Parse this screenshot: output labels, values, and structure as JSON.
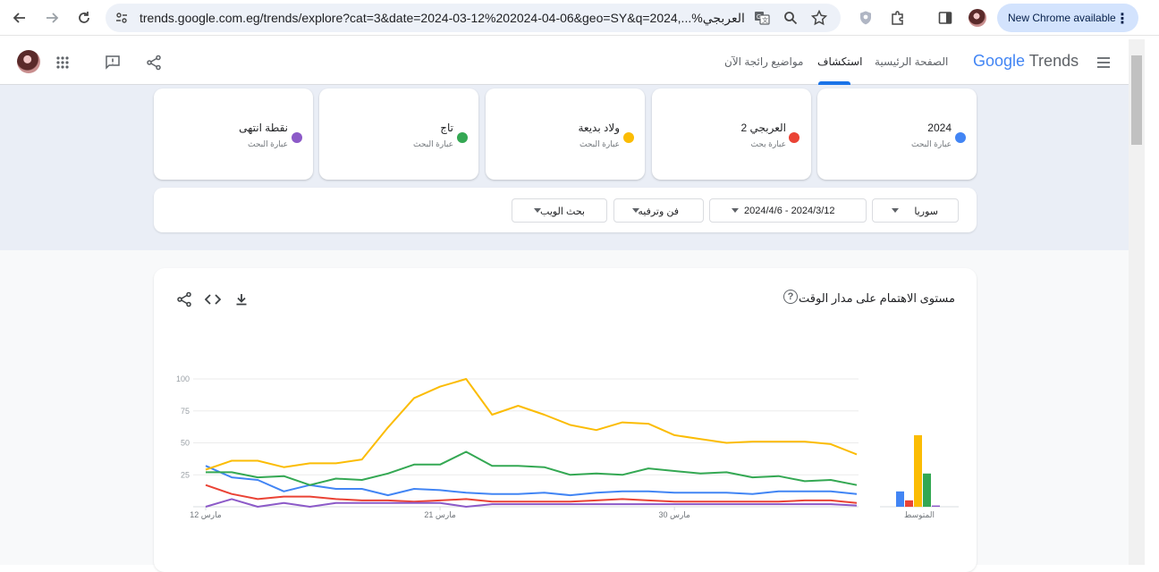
{
  "browser": {
    "url": "trends.google.com.eg/trends/explore?cat=3&date=2024-03-12%202024-04-06&geo=SY&q=2024,...%العربجي",
    "update_label": "New Chrome available"
  },
  "header": {
    "logo_google": "Google",
    "logo_trends": "Trends",
    "nav": [
      {
        "label": "الصفحة الرئيسية"
      },
      {
        "label": "استكشاف"
      },
      {
        "label": "مواضيع رائجة الآن"
      }
    ]
  },
  "terms": [
    {
      "term": "2024",
      "sub": "عبارة البحث",
      "color": "#4285f4"
    },
    {
      "term": "العربجي 2",
      "sub": "عبارة بحث",
      "color": "#ea4335"
    },
    {
      "term": "ولاد بديعة",
      "sub": "عبارة البحث",
      "color": "#fbbc04"
    },
    {
      "term": "تاج",
      "sub": "عبارة البحث",
      "color": "#34a853"
    },
    {
      "term": "نقطة انتهى",
      "sub": "عبارة البحث",
      "color": "#8c5ac8"
    }
  ],
  "filters": {
    "geo": "سوريا",
    "date": "2024/4/6 - 2024/3/12",
    "category": "فن وترفيه",
    "search_type": "بحث الويب"
  },
  "chart_section": {
    "title": "مستوى الاهتمام على مدار الوقت"
  },
  "chart_data": {
    "type": "line",
    "title": "",
    "xlabel": "",
    "ylabel": "",
    "ylim": [
      0,
      100
    ],
    "y_ticks": [
      "100",
      "75",
      "50",
      "25"
    ],
    "x_tick_labels": [
      "12 مارس",
      "21 مارس",
      "30 مارس"
    ],
    "x": [
      "2024-03-12",
      "2024-03-13",
      "2024-03-14",
      "2024-03-15",
      "2024-03-16",
      "2024-03-17",
      "2024-03-18",
      "2024-03-19",
      "2024-03-20",
      "2024-03-21",
      "2024-03-22",
      "2024-03-23",
      "2024-03-24",
      "2024-03-25",
      "2024-03-26",
      "2024-03-27",
      "2024-03-28",
      "2024-03-29",
      "2024-03-30",
      "2024-03-31",
      "2024-04-01",
      "2024-04-02",
      "2024-04-03",
      "2024-04-04",
      "2024-04-05",
      "2024-04-06"
    ],
    "series": [
      {
        "name": "2024",
        "color": "#4285f4",
        "values": [
          32,
          23,
          21,
          12,
          17,
          14,
          14,
          9,
          14,
          13,
          11,
          10,
          10,
          11,
          9,
          11,
          12,
          12,
          11,
          11,
          11,
          10,
          12,
          12,
          12,
          10
        ]
      },
      {
        "name": "العربجي 2",
        "color": "#ea4335",
        "values": [
          17,
          10,
          6,
          8,
          8,
          6,
          5,
          5,
          4,
          5,
          6,
          4,
          4,
          4,
          4,
          5,
          6,
          5,
          4,
          4,
          4,
          4,
          4,
          5,
          5,
          3
        ]
      },
      {
        "name": "ولاد بديعة",
        "color": "#fbbc04",
        "values": [
          29,
          36,
          36,
          31,
          34,
          34,
          37,
          62,
          85,
          94,
          100,
          72,
          79,
          72,
          64,
          60,
          66,
          65,
          56,
          53,
          50,
          51,
          51,
          51,
          49,
          41
        ]
      },
      {
        "name": "تاج",
        "color": "#34a853",
        "values": [
          27,
          27,
          23,
          24,
          17,
          22,
          21,
          26,
          33,
          33,
          43,
          32,
          32,
          31,
          25,
          26,
          25,
          30,
          28,
          26,
          27,
          23,
          24,
          20,
          21,
          17
        ]
      },
      {
        "name": "نقطة انتهى",
        "color": "#8c5ac8",
        "values": [
          0,
          6,
          0,
          3,
          0,
          3,
          3,
          3,
          3,
          3,
          0,
          2,
          2,
          2,
          2,
          2,
          2,
          2,
          2,
          2,
          2,
          2,
          2,
          2,
          2,
          1
        ]
      }
    ],
    "averages_label": "المتوسط",
    "averages": [
      12,
      5,
      56,
      26,
      1
    ]
  }
}
